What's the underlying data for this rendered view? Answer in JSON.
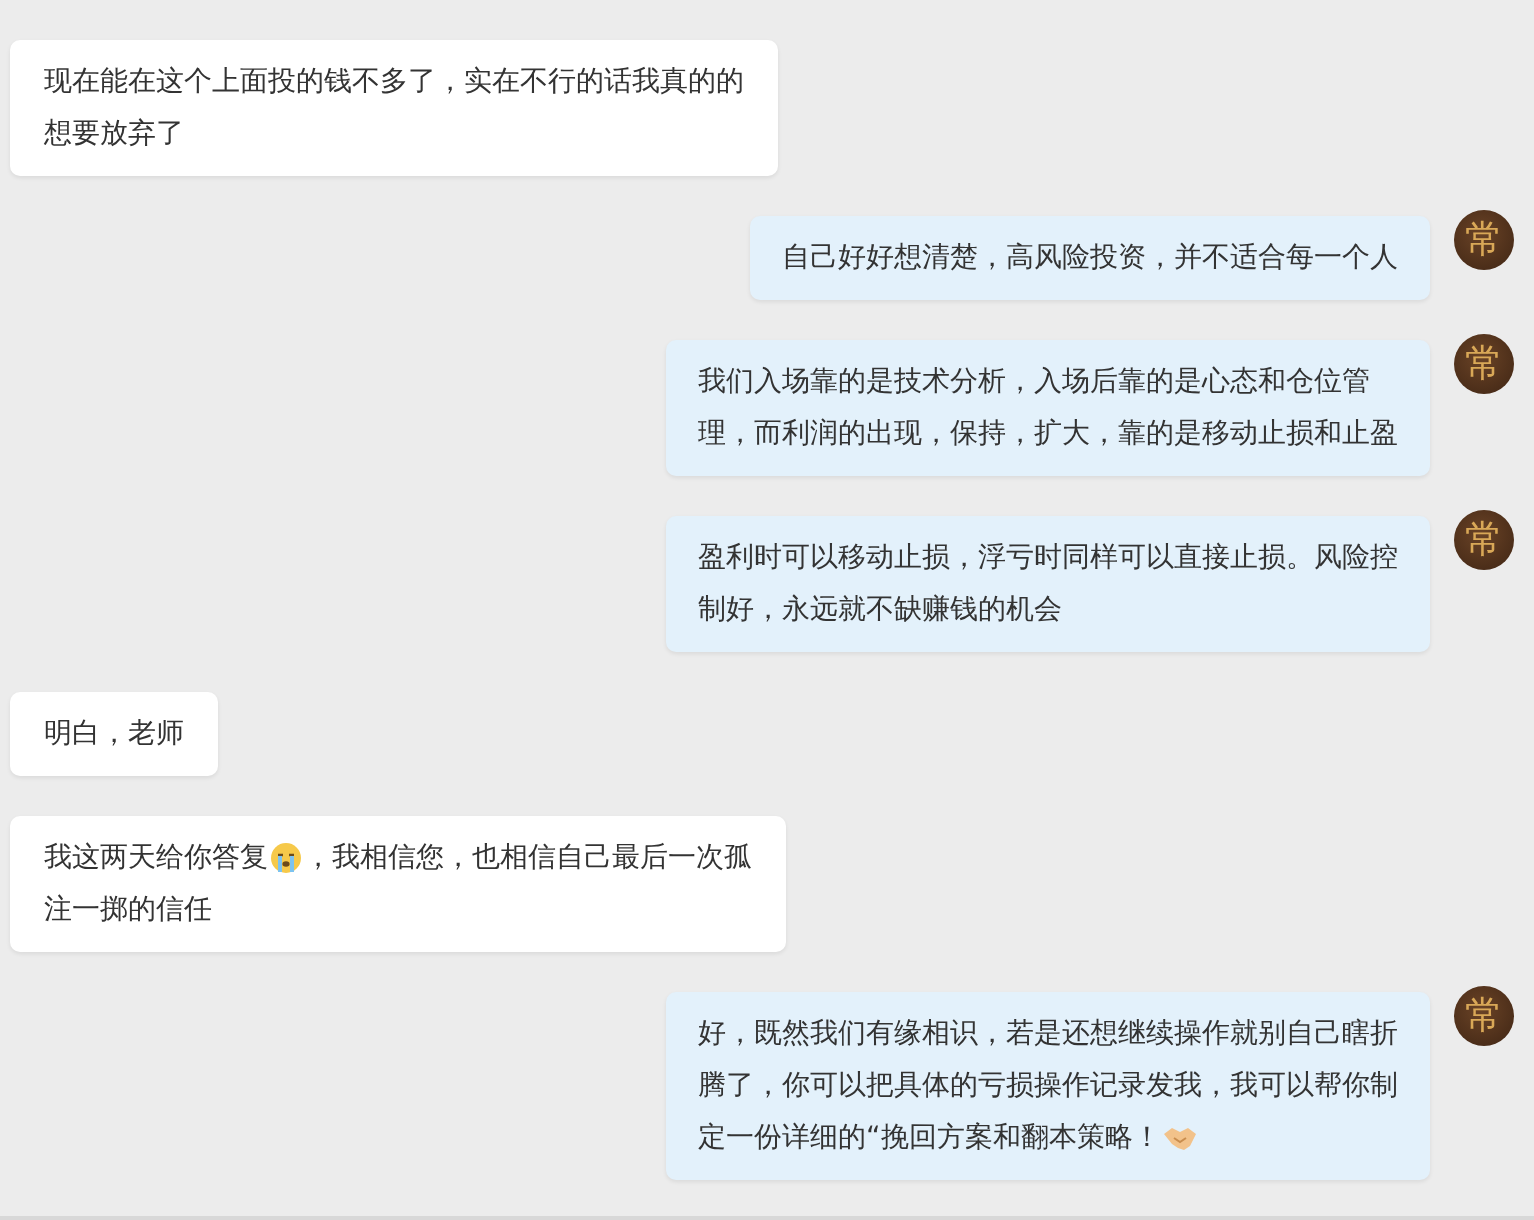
{
  "messages": [
    {
      "outgoing": false,
      "lines": [
        [
          {
            "kind": "text",
            "text": "现在能在这个上面投的钱不多了，实在不行的话我真的的"
          }
        ],
        [
          {
            "kind": "text",
            "text": "想要放弃了"
          }
        ]
      ]
    },
    {
      "outgoing": true,
      "avatar": "常",
      "lines": [
        [
          {
            "kind": "text",
            "text": "自己好好想清楚，高风险投资，并不适合每一个人"
          }
        ]
      ]
    },
    {
      "outgoing": true,
      "avatar": "常",
      "lines": [
        [
          {
            "kind": "text",
            "text": "我们入场靠的是技术分析，入场后靠的是心态和仓位管"
          }
        ],
        [
          {
            "kind": "text",
            "text": "理，而利润的出现，保持，扩大，靠的是移动止损和止盈"
          }
        ]
      ]
    },
    {
      "outgoing": true,
      "avatar": "常",
      "lines": [
        [
          {
            "kind": "text",
            "text": "盈利时可以移动止损，浮亏时同样可以直接止损。风险控"
          }
        ],
        [
          {
            "kind": "text",
            "text": "制好，永远就不缺赚钱的机会"
          }
        ]
      ]
    },
    {
      "outgoing": false,
      "lines": [
        [
          {
            "kind": "text",
            "text": "明白，老师"
          }
        ]
      ]
    },
    {
      "outgoing": false,
      "lines": [
        [
          {
            "kind": "text",
            "text": "我这两天给你答复"
          },
          {
            "kind": "crying"
          },
          {
            "kind": "text",
            "text": "，我相信您，也相信自己最后一次孤"
          }
        ],
        [
          {
            "kind": "text",
            "text": "注一掷的信任"
          }
        ]
      ]
    },
    {
      "outgoing": true,
      "avatar": "常",
      "lines": [
        [
          {
            "kind": "text",
            "text": "好，既然我们有缘相识，若是还想继续操作就别自己瞎折"
          }
        ],
        [
          {
            "kind": "text",
            "text": "腾了，你可以把具体的亏损操作记录发我，我可以帮你制"
          }
        ],
        [
          {
            "kind": "text",
            "text": "定一份详细的“挽回方案和翻本策略！"
          },
          {
            "kind": "handshake"
          }
        ]
      ]
    }
  ]
}
